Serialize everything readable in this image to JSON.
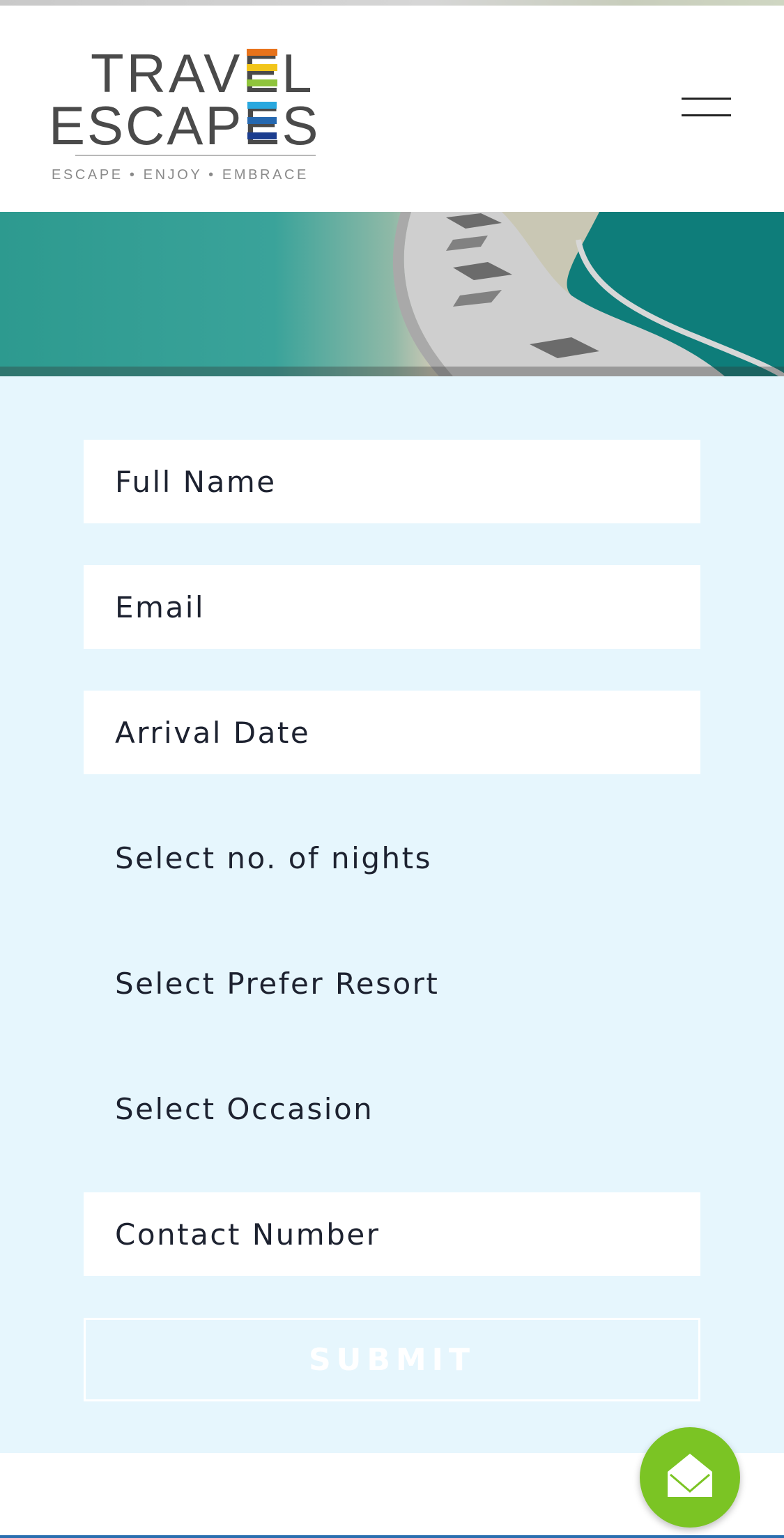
{
  "brand": {
    "logo_title_line1": "TRAVEL",
    "logo_title_line2": "ESCAPES",
    "logo_tagline": "ESCAPE • ENJOY • EMBRACE",
    "logo_stripe_colors": [
      "#e8731b",
      "#f2c51a",
      "#8fc43b",
      "#29a8df",
      "#2568b0",
      "#1b3d8f"
    ],
    "text_color": "#4a4a4a"
  },
  "header": {
    "menu_icon": "hamburger-menu-icon"
  },
  "hero": {
    "image_description_icon": "pool-deck-umbrellas-image"
  },
  "form": {
    "full_name": {
      "placeholder": "Full Name"
    },
    "email": {
      "placeholder": "Email"
    },
    "arrival_date": {
      "placeholder": "Arrival Date"
    },
    "nights": {
      "selected": "Select no. of nights"
    },
    "resort": {
      "selected": "Select Prefer Resort"
    },
    "occasion": {
      "selected": "Select Occasion"
    },
    "contact_number": {
      "placeholder": "Contact Number"
    },
    "submit_label": "SUBMIT",
    "background_color": "#e6f6fd"
  },
  "fab": {
    "icon": "open-envelope-icon",
    "color": "#7bc424"
  }
}
